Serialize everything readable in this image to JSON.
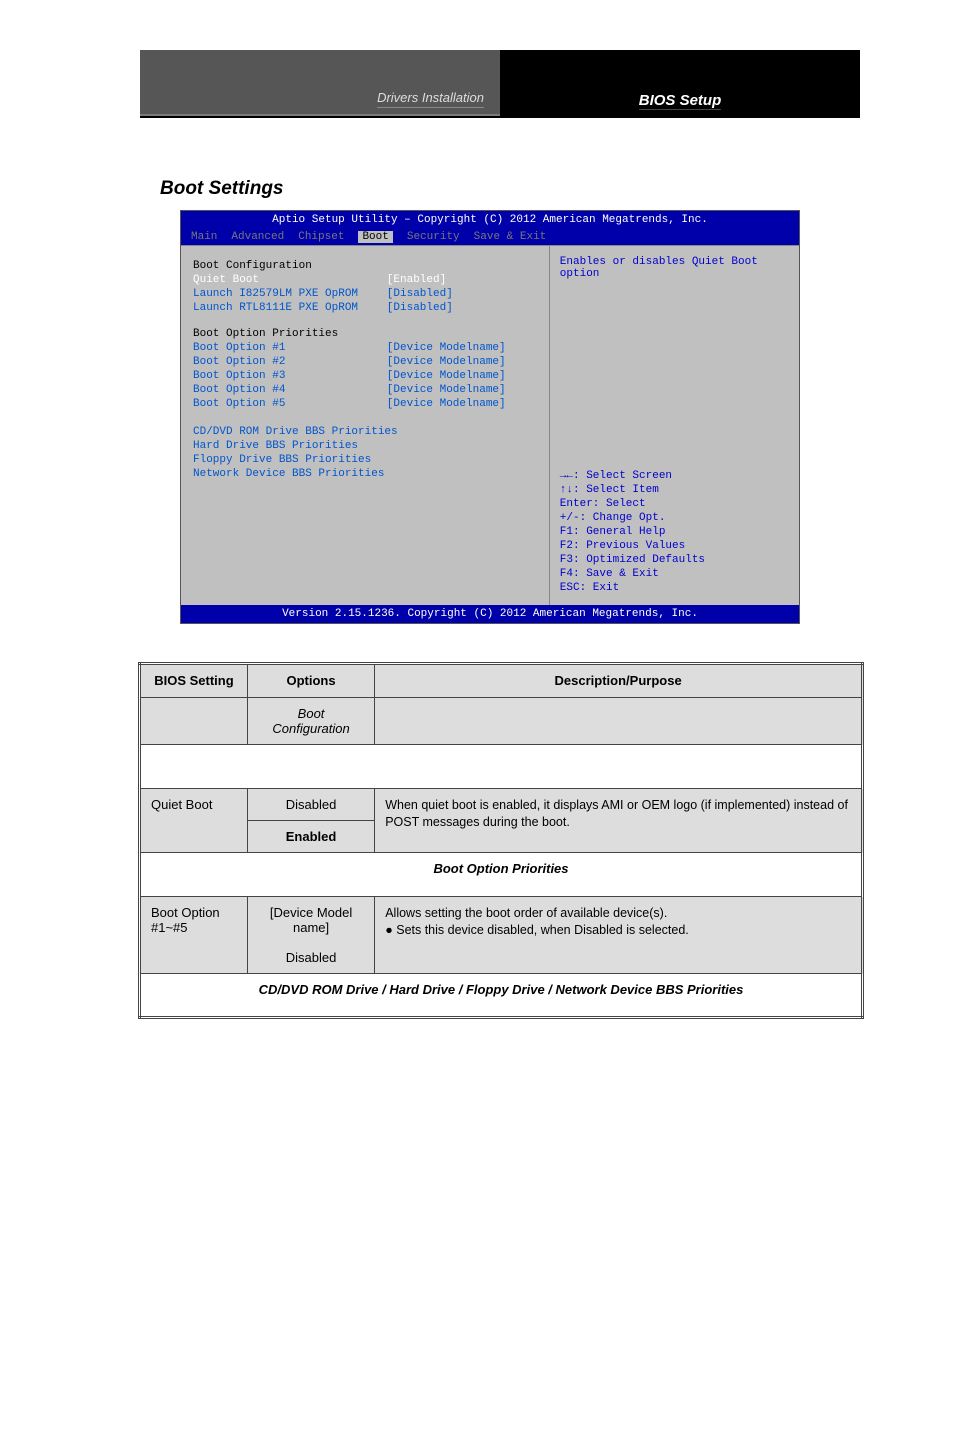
{
  "header": {
    "left": "Drivers Installation",
    "right": "BIOS Setup"
  },
  "section_title": "Boot Settings",
  "bios": {
    "title": "Aptio Setup Utility – Copyright (C) 2012 American Megatrends, Inc.",
    "tabs": [
      "Main",
      "Advanced",
      "Chipset",
      "Boot",
      "Security",
      "Save & Exit"
    ],
    "active_tab": "Boot",
    "groups": [
      {
        "heading": "Boot Configuration",
        "rows": [
          {
            "label": "Quiet Boot",
            "value": "[Enabled]",
            "selected": true
          },
          {
            "label": "Launch I82579LM PXE OpROM",
            "value": "[Disabled]"
          },
          {
            "label": "Launch RTL8111E PXE OpROM",
            "value": "[Disabled]"
          }
        ]
      },
      {
        "heading": "Boot Option Priorities",
        "rows": [
          {
            "label": "Boot Option #1",
            "value": "[Device Modelname]"
          },
          {
            "label": "Boot Option #2",
            "value": "[Device Modelname]"
          },
          {
            "label": "Boot Option #3",
            "value": "[Device Modelname]"
          },
          {
            "label": "Boot Option #4",
            "value": "[Device Modelname]"
          },
          {
            "label": "Boot Option #5",
            "value": "[Device Modelname]"
          }
        ]
      },
      {
        "heading": "",
        "rows": [
          {
            "label": "CD/DVD ROM Drive BBS Priorities",
            "value": ""
          },
          {
            "label": "Hard Drive BBS Priorities",
            "value": ""
          },
          {
            "label": "Floppy Drive BBS Priorities",
            "value": ""
          },
          {
            "label": "Network Device BBS Priorities",
            "value": ""
          }
        ]
      }
    ],
    "help_text": "Enables or disables Quiet Boot option",
    "help_keys": [
      "→←: Select Screen",
      "↑↓: Select Item",
      "Enter: Select",
      "+/-: Change Opt.",
      "F1: General Help",
      "F2: Previous Values",
      "F3: Optimized Defaults",
      "F4: Save & Exit",
      "ESC: Exit"
    ],
    "footer": "Version 2.15.1236. Copyright (C) 2012 American Megatrends, Inc."
  },
  "table": {
    "head": {
      "c1": "BIOS Setting",
      "c2": "Options",
      "c3": "Description/Purpose"
    },
    "subhead": {
      "c2": "Boot Configuration"
    },
    "rows": [
      {
        "setting": "Quiet Boot",
        "options": [
          "Disabled",
          "Enabled"
        ],
        "default": "Enabled",
        "desc": "When quiet boot is enabled, it displays AMI or OEM logo (if implemented) instead of POST messages during the boot."
      }
    ],
    "section1": "Boot Option Priorities",
    "row2": {
      "setting": "Boot Option #1~#5",
      "options": "[Device Model name]\n\nDisabled",
      "desc": "Allows setting the boot order of available device(s).\n● Sets this device disabled, when Disabled is selected."
    },
    "section2": "CD/DVD ROM Drive / Hard Drive / Floppy Drive / Network Device BBS Priorities"
  }
}
